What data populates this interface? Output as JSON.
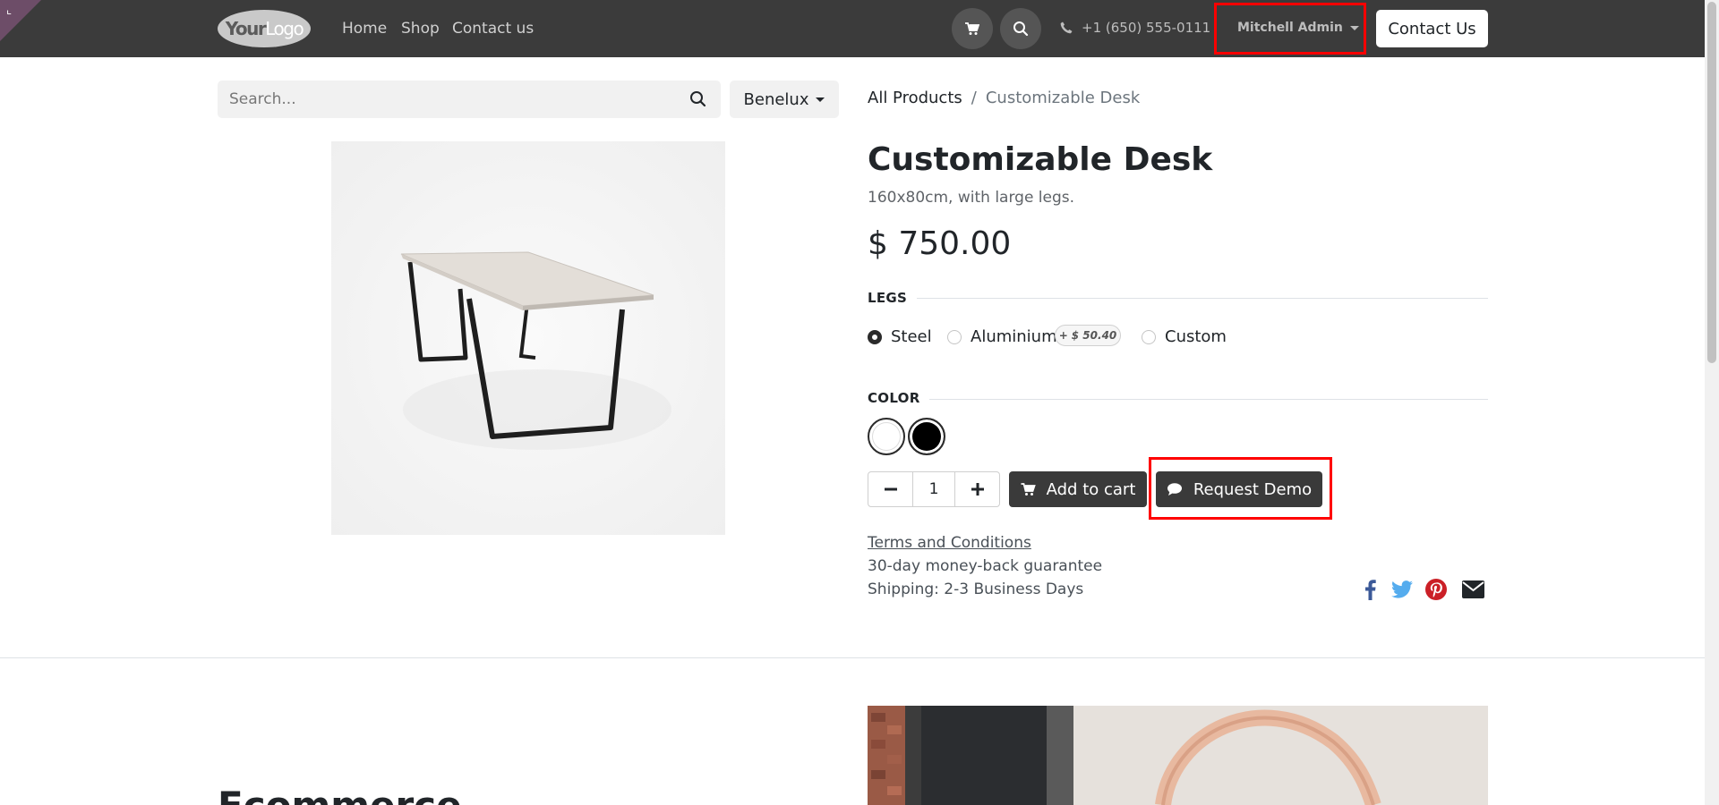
{
  "header": {
    "logo_text_bold": "Your",
    "logo_text_light": "Logo",
    "nav": [
      "Home",
      "Shop",
      "Contact us"
    ],
    "phone": "+1 (650) 555-0111",
    "user_name": "Mitchell Admin",
    "contact_button": "Contact Us"
  },
  "search": {
    "placeholder": "Search...",
    "pricelist": "Benelux"
  },
  "breadcrumb": {
    "parent": "All Products",
    "separator": "/",
    "current": "Customizable Desk"
  },
  "product": {
    "name": "Customizable Desk",
    "description": "160x80cm, with large legs.",
    "price": "$ 750.00",
    "attributes": {
      "legs": {
        "label": "LEGS",
        "options": [
          "Steel",
          "Aluminium",
          "Custom"
        ],
        "selected": "Steel",
        "extra_sign": "+",
        "extra_price": "$ 50.40"
      },
      "color": {
        "label": "COLOR",
        "swatches": [
          "#ffffff",
          "#000000"
        ],
        "selected": "#000000"
      }
    },
    "quantity": "1",
    "add_to_cart": "Add to cart",
    "request_demo": "Request Demo",
    "terms": "Terms and Conditions",
    "guarantee": "30-day money-back guarantee",
    "shipping": "Shipping: 2-3 Business Days"
  },
  "share_icons": [
    "facebook-icon",
    "twitter-icon",
    "pinterest-icon",
    "envelope-icon"
  ],
  "colors": {
    "navbar": "#3b3b3b",
    "button_dark": "#3a3a3a",
    "highlight": "#ff0000",
    "facebook": "#3b5998",
    "twitter": "#55acee",
    "pinterest": "#cb2027"
  },
  "section": {
    "heading": "Ecommerce"
  }
}
